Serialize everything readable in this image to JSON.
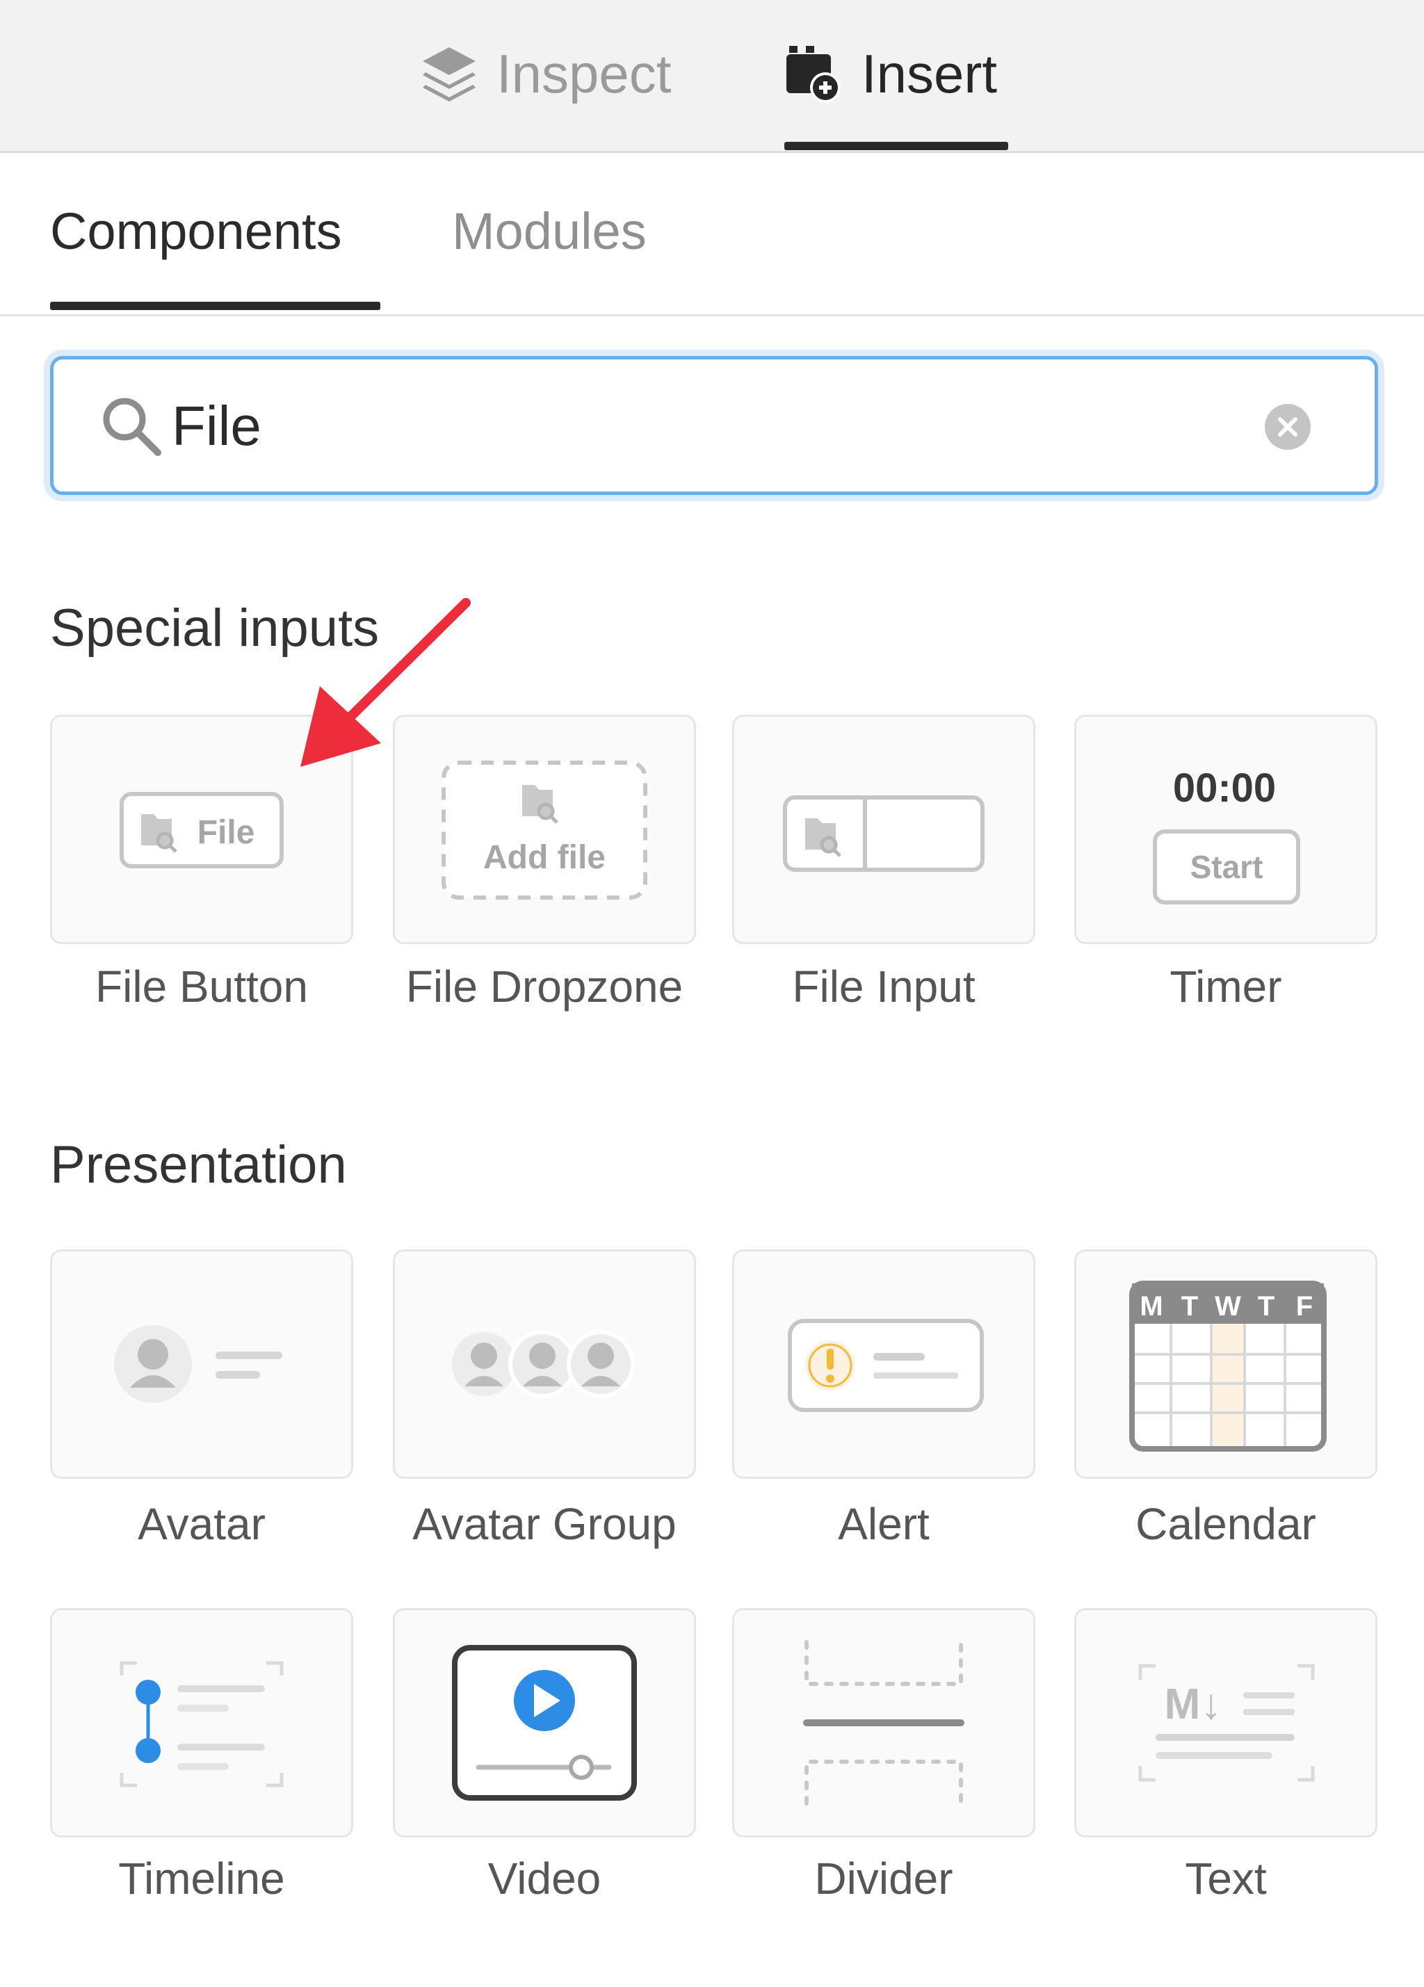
{
  "tabs": {
    "inspect": "Inspect",
    "insert": "Insert"
  },
  "subtabs": {
    "components": "Components",
    "modules": "Modules"
  },
  "search": {
    "value": "File"
  },
  "sections": {
    "special_inputs": {
      "title": "Special inputs",
      "items": [
        {
          "label": "File Button",
          "preview_text": "File"
        },
        {
          "label": "File Dropzone",
          "preview_text": "Add file"
        },
        {
          "label": "File Input"
        },
        {
          "label": "Timer",
          "preview_time": "00:00",
          "preview_button": "Start"
        }
      ]
    },
    "presentation": {
      "title": "Presentation",
      "items": [
        {
          "label": "Avatar"
        },
        {
          "label": "Avatar Group"
        },
        {
          "label": "Alert"
        },
        {
          "label": "Calendar",
          "preview_days": [
            "M",
            "T",
            "W",
            "T",
            "F"
          ]
        },
        {
          "label": "Timeline"
        },
        {
          "label": "Video"
        },
        {
          "label": "Divider"
        },
        {
          "label": "Text",
          "preview_text": "M↓"
        }
      ]
    }
  },
  "colors": {
    "accent": "#2d8ce6",
    "search_focus": "#6aaeea",
    "annotation_arrow": "#ee2d3c",
    "highlight_column": "#fdf1e2",
    "alert_yellow": "#f5b935"
  }
}
